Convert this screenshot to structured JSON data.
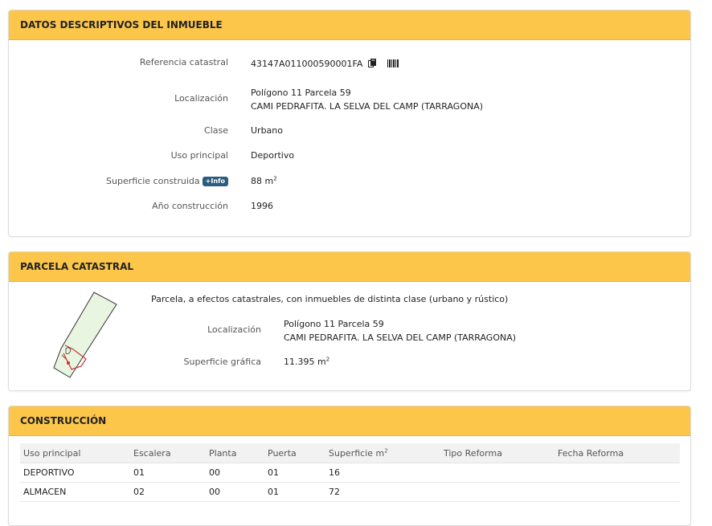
{
  "inmueble": {
    "title": "DATOS DESCRIPTIVOS DEL INMUEBLE",
    "ref_label": "Referencia catastral",
    "ref_value": "43147A011000590001FA",
    "loc_label": "Localización",
    "loc_line1": "Polígono 11 Parcela 59",
    "loc_line2": "CAMI PEDRAFITA. LA SELVA DEL CAMP (TARRAGONA)",
    "clase_label": "Clase",
    "clase_value": "Urbano",
    "uso_label": "Uso principal",
    "uso_value": "Deportivo",
    "sup_label": "Superficie construida",
    "info_badge": "+Info",
    "sup_value": "88 m",
    "sup_exp": "2",
    "anio_label": "Año construcción",
    "anio_value": "1996"
  },
  "parcela": {
    "title": "PARCELA CATASTRAL",
    "desc": "Parcela, a efectos catastrales, con inmuebles de distinta clase (urbano y rústico)",
    "loc_label": "Localización",
    "loc_line1": "Polígono 11 Parcela 59",
    "loc_line2": "CAMI PEDRAFITA. LA SELVA DEL CAMP (TARRAGONA)",
    "sup_label": "Superficie gráfica",
    "sup_value": "11.395 m",
    "sup_exp": "2"
  },
  "construccion": {
    "title": "CONSTRUCCIÓN",
    "headers": [
      "Uso principal",
      "Escalera",
      "Planta",
      "Puerta",
      "Superficie m",
      "Tipo Reforma",
      "Fecha Reforma"
    ],
    "sup_header_exp": "2",
    "rows": [
      [
        "DEPORTIVO",
        "01",
        "00",
        "01",
        "16",
        "",
        ""
      ],
      [
        "ALMACEN",
        "02",
        "00",
        "01",
        "72",
        "",
        ""
      ]
    ]
  },
  "icons": {
    "copy": "copy-icon",
    "barcode": "barcode-icon",
    "parcel_map": "parcel-map-icon"
  },
  "colors": {
    "header_bg": "#fbc64a",
    "badge_bg": "#2a5d80",
    "parcel_fill": "#e8f5e0",
    "parcel_outline": "#cc3333"
  }
}
